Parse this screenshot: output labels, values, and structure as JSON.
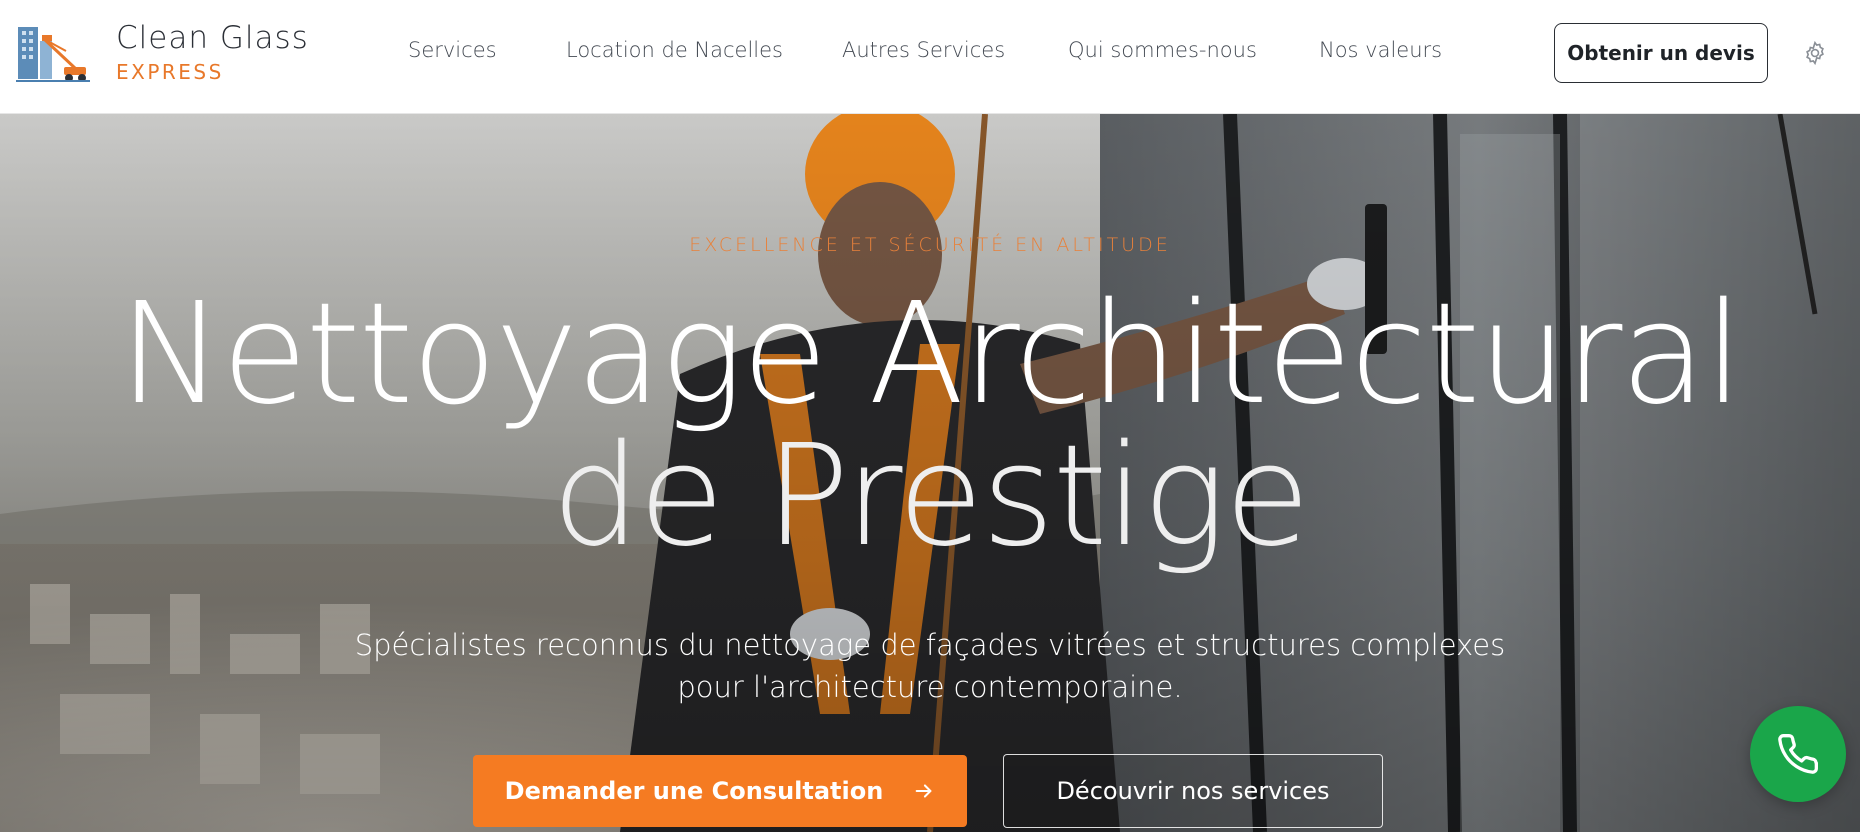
{
  "brand": {
    "name": "Clean Glass",
    "tagline": "EXPRESS"
  },
  "nav": {
    "items": [
      {
        "label": "Services"
      },
      {
        "label": "Location de Nacelles"
      },
      {
        "label": "Autres Services"
      },
      {
        "label": "Qui sommes-nous"
      },
      {
        "label": "Nos valeurs"
      }
    ],
    "cta_label": "Obtenir un devis"
  },
  "hero": {
    "eyebrow": "EXCELLENCE ET SÉCURITÉ EN ALTITUDE",
    "headline_line1": "Nettoyage Architectural",
    "headline_line2": "de Prestige",
    "subtitle_line1": "Spécialistes reconnus du nettoyage de façades vitrées et structures complexes",
    "subtitle_line2": "pour l'architecture contemporaine.",
    "primary_button": "Demander une Consultation",
    "secondary_button": "Découvrir nos services"
  },
  "colors": {
    "accent": "#f57b22",
    "brand_orange": "#e8782a",
    "phone_green": "#1aa64a",
    "text_dark": "#2b2f36"
  },
  "icons": {
    "logo": "building-crane-logo",
    "settings": "gear-icon",
    "arrow": "arrow-right-icon",
    "phone": "phone-icon"
  }
}
